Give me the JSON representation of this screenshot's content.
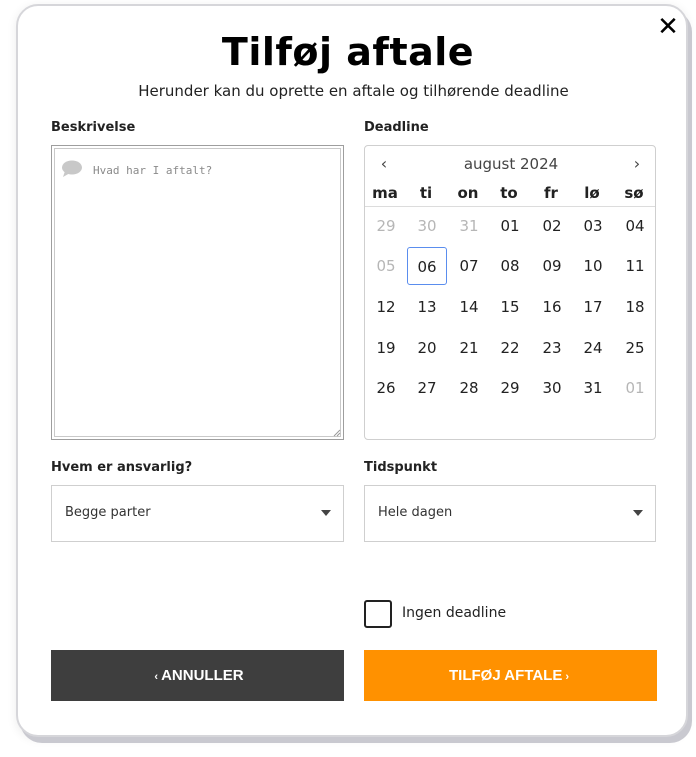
{
  "dialog": {
    "close_symbol": "✕",
    "title": "Tilføj aftale",
    "subtitle": "Herunder kan du oprette en aftale og tilhørende deadline"
  },
  "description": {
    "label": "Beskrivelse",
    "placeholder": "Hvad har I aftalt?",
    "icon": "speech-bubble-icon"
  },
  "deadline": {
    "label": "Deadline",
    "calendar": {
      "month_label": "august 2024",
      "prev_symbol": "‹",
      "next_symbol": "›",
      "weekdays": [
        "ma",
        "ti",
        "on",
        "to",
        "fr",
        "lø",
        "sø"
      ],
      "weeks": [
        [
          "29",
          "30",
          "31",
          "01",
          "02",
          "03",
          "04"
        ],
        [
          "05",
          "06",
          "07",
          "08",
          "09",
          "10",
          "11"
        ],
        [
          "12",
          "13",
          "14",
          "15",
          "16",
          "17",
          "18"
        ],
        [
          "19",
          "20",
          "21",
          "22",
          "23",
          "24",
          "25"
        ],
        [
          "26",
          "27",
          "28",
          "29",
          "30",
          "31",
          "01"
        ]
      ],
      "selected_day": "06"
    }
  },
  "responsible": {
    "label": "Hvem er ansvarlig?",
    "selected": "Begge parter"
  },
  "time": {
    "label": "Tidspunkt",
    "selected": "Hele dagen"
  },
  "no_deadline": {
    "label": "Ingen deadline",
    "checked": false
  },
  "buttons": {
    "cancel_label": "ANNULLER",
    "cancel_prefix": "‹",
    "add_label": "TILFØJ AFTALE",
    "add_suffix": "›"
  },
  "colors": {
    "primary_button": "#ff9100",
    "secondary_button": "#3e3e3e",
    "selected_day_border": "#5a8dee"
  }
}
